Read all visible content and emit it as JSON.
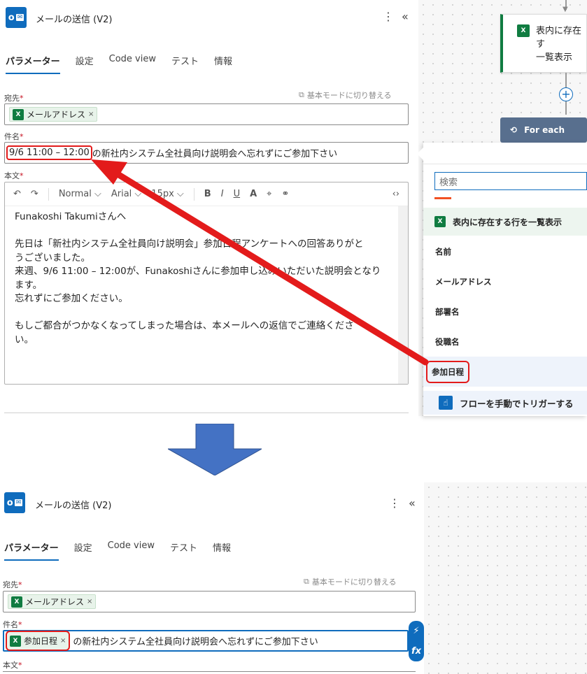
{
  "panel1": {
    "title": "メールの送信 (V2)",
    "logo_text": "o",
    "tabs": [
      "パラメーター",
      "設定",
      "Code view",
      "テスト",
      "情報"
    ],
    "to_label": "宛先",
    "switch_label": "基本モードに切り替える",
    "to_chip": "メールアドレス",
    "subject_label": "件名",
    "subject_value_highlight": "9/6 11:00 – 12:00",
    "subject_value_rest": "の新社内システム全社員向け説明会へ忘れずにご参加下さい",
    "body_label": "本文",
    "toolbar": {
      "font": "Normal",
      "face": "Arial",
      "size": "15px"
    },
    "body_lines": [
      "Funakoshi Takumiさんへ",
      "",
      "先日は「新社内システム全社員向け説明会」参加日程アンケートへの回答ありがと",
      "うございました。",
      "来週、9/6 11:00 – 12:00が、Funakoshiさんに参加申し込みいただいた説明会となり",
      "ます。",
      "忘れずにご参加ください。",
      "",
      "もしご都合がつかなくなってしまった場合は、本メールへの返信でご連絡くださ",
      "い。"
    ]
  },
  "canvas": {
    "node_label_1": "表内に存在す",
    "node_label_2": "一覧表示",
    "foreach_label": "For each"
  },
  "flyout": {
    "search_placeholder": "検索",
    "section_title": "表内に存在する行を一覧表示",
    "items": [
      "名前",
      "メールアドレス",
      "部署名",
      "役職名",
      "参加日程"
    ],
    "trigger_title": "フローを手動でトリガーする"
  },
  "panel2": {
    "title": "メールの送信 (V2)",
    "tabs": [
      "パラメーター",
      "設定",
      "Code view",
      "テスト",
      "情報"
    ],
    "to_label": "宛先",
    "switch_label": "基本モードに切り替える",
    "to_chip": "メールアドレス",
    "subject_label": "件名",
    "subject_chip": "参加日程",
    "subject_rest": "の新社内システム全社員向け説明会へ忘れずにご参加下さい",
    "body_label": "本文"
  },
  "colors": {
    "accent": "#0f6cbd",
    "excel": "#107c41",
    "arrow": "#e31b1b",
    "down_arrow": "#4472c4"
  }
}
